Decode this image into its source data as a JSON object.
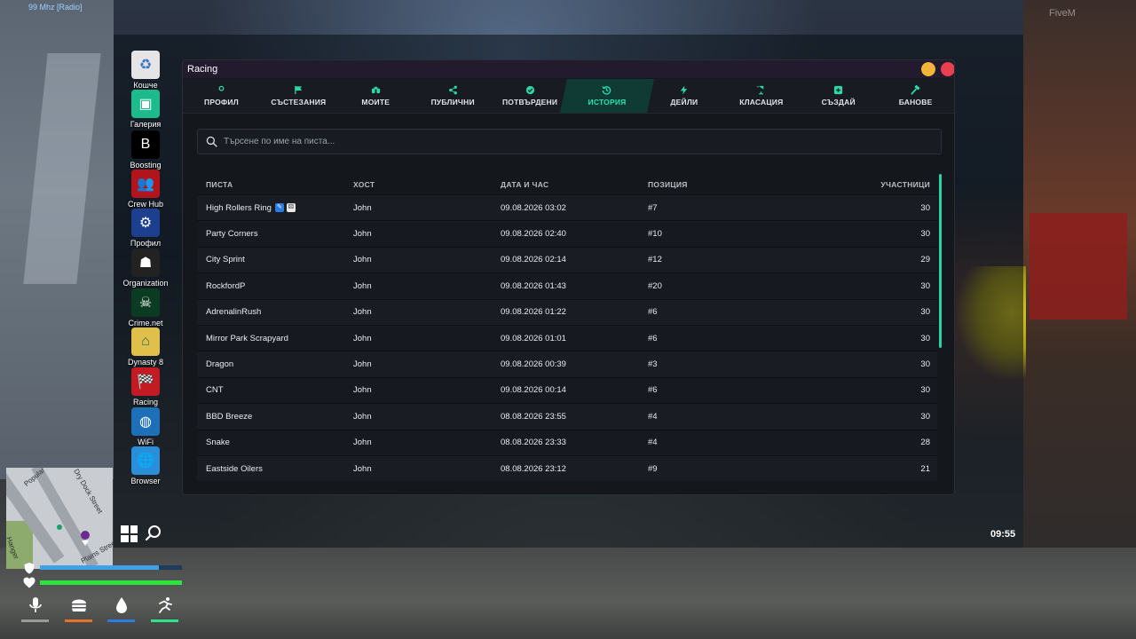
{
  "overlay": {
    "radio": "99 Mhz [Radio]",
    "brand": "FiveM"
  },
  "desktop": {
    "icons": [
      {
        "label": "Кошче",
        "icon": "recycle-bin-icon",
        "color": "#e5e5e5"
      },
      {
        "label": "Галерия",
        "icon": "gallery-icon",
        "color": "#1dbb8b"
      },
      {
        "label": "Boosting",
        "icon": "boosting-icon",
        "color": "#000000"
      },
      {
        "label": "Crew Hub",
        "icon": "crew-hub-icon",
        "color": "#b3131b"
      },
      {
        "label": "Профил",
        "icon": "profile-icon",
        "color": "#1c3f8f"
      },
      {
        "label": "Organization",
        "icon": "organization-icon",
        "color": "#222222"
      },
      {
        "label": "Crime.net",
        "icon": "crime-net-icon",
        "color": "#0b3b20"
      },
      {
        "label": "Dynasty 8",
        "icon": "dynasty8-icon",
        "color": "#e0c04a"
      },
      {
        "label": "Racing",
        "icon": "racing-icon",
        "color": "#c41a24"
      },
      {
        "label": "WiFi",
        "icon": "wifi-icon",
        "color": "#1d6fb8"
      },
      {
        "label": "Browser",
        "icon": "browser-icon",
        "color": "#2a8fd8"
      }
    ]
  },
  "taskbar": {
    "clock": "09:55"
  },
  "window": {
    "title": "Racing",
    "tabs": [
      {
        "label": "ПРОФИЛ",
        "icon": "user-icon",
        "active": false
      },
      {
        "label": "СЪСТЕЗАНИЯ",
        "icon": "flag-icon",
        "active": false
      },
      {
        "label": "МОИТЕ",
        "icon": "binoculars-icon",
        "active": false
      },
      {
        "label": "ПУБЛИЧНИ",
        "icon": "share-icon",
        "active": false
      },
      {
        "label": "ПОТВЪРДЕНИ",
        "icon": "check-circle-icon",
        "active": false
      },
      {
        "label": "ИСТОРИЯ",
        "icon": "history-icon",
        "active": true
      },
      {
        "label": "ДЕЙЛИ",
        "icon": "bolt-icon",
        "active": false
      },
      {
        "label": "КЛАСАЦИЯ",
        "icon": "trophy-icon",
        "active": false
      },
      {
        "label": "СЪЗДАЙ",
        "icon": "plus-square-icon",
        "active": false
      },
      {
        "label": "БАНОВЕ",
        "icon": "hammer-icon",
        "active": false
      }
    ],
    "search": {
      "placeholder": "Търсене по име на писта..."
    },
    "table": {
      "headers": [
        "ПИСТА",
        "ХОСТ",
        "ДАТА И ЧАС",
        "ПОЗИЦИЯ",
        "УЧАСТНИЦИ"
      ],
      "rows": [
        {
          "track": "High Rollers Ring",
          "host": "John",
          "datetime": "09.08.2026 03:02",
          "position": "#7",
          "participants": "30",
          "badges": true
        },
        {
          "track": "Party Corners",
          "host": "John",
          "datetime": "09.08.2026 02:40",
          "position": "#10",
          "participants": "30"
        },
        {
          "track": "City Sprint",
          "host": "John",
          "datetime": "09.08.2026 02:14",
          "position": "#12",
          "participants": "29"
        },
        {
          "track": "RockfordP",
          "host": "John",
          "datetime": "09.08.2026 01:43",
          "position": "#20",
          "participants": "30"
        },
        {
          "track": "AdrenalinRush",
          "host": "John",
          "datetime": "09.08.2026 01:22",
          "position": "#6",
          "participants": "30"
        },
        {
          "track": "Mirror Park Scrapyard",
          "host": "John",
          "datetime": "09.08.2026 01:01",
          "position": "#6",
          "participants": "30"
        },
        {
          "track": "Dragon",
          "host": "John",
          "datetime": "09.08.2026 00:39",
          "position": "#3",
          "participants": "30"
        },
        {
          "track": "CNT",
          "host": "John",
          "datetime": "09.08.2026 00:14",
          "position": "#6",
          "participants": "30"
        },
        {
          "track": "BBD Breeze",
          "host": "John",
          "datetime": "08.08.2026 23:55",
          "position": "#4",
          "participants": "30"
        },
        {
          "track": "Snake",
          "host": "John",
          "datetime": "08.08.2026 23:33",
          "position": "#4",
          "participants": "28"
        },
        {
          "track": "Eastside Oilers",
          "host": "John",
          "datetime": "08.08.2026 23:12",
          "position": "#9",
          "participants": "21"
        }
      ]
    }
  },
  "hud": {
    "map_labels": [
      "Dry Dock Street",
      "Popular",
      "Hanger",
      "Plains Street"
    ],
    "armor_fraction": 0.84,
    "health_fraction": 1.0,
    "status_icons": [
      {
        "icon": "microphone-icon",
        "bar_color": "#9a9a9a"
      },
      {
        "icon": "burger-icon",
        "bar_color": "#e8722a"
      },
      {
        "icon": "water-drop-icon",
        "bar_color": "#2a7be4"
      },
      {
        "icon": "stamina-icon",
        "bar_color": "#2ee38a"
      }
    ],
    "colors": {
      "armor": "#3fa2e8",
      "health": "#2ee33e",
      "accent": "#28e0b0"
    }
  }
}
